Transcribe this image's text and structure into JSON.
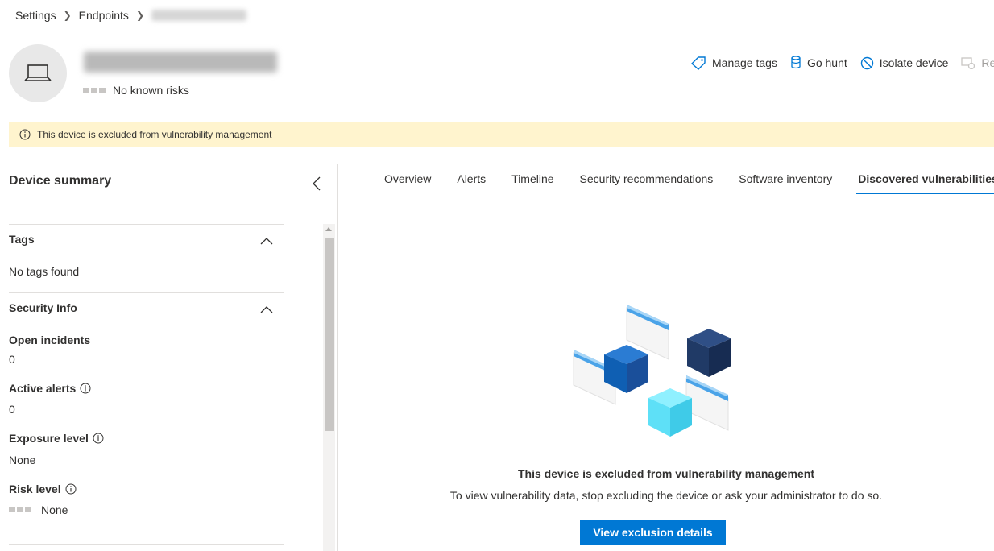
{
  "breadcrumb": {
    "items": [
      "Settings",
      "Endpoints"
    ],
    "current_redacted": true
  },
  "device": {
    "name_redacted": true,
    "risk_text": "No known risks"
  },
  "actions": [
    {
      "label": "Manage tags",
      "icon": "tag-icon"
    },
    {
      "label": "Go hunt",
      "icon": "hunt-icon"
    },
    {
      "label": "Isolate device",
      "icon": "block-icon"
    },
    {
      "label": "Re",
      "icon": "restrict-icon",
      "disabled": true
    }
  ],
  "banner": {
    "text": "This device is excluded from vulnerability management",
    "color": "#fff4ce"
  },
  "summary": {
    "title": "Device summary",
    "tags_section": {
      "title": "Tags",
      "empty_text": "No tags found"
    },
    "security_section": {
      "title": "Security Info",
      "fields": [
        {
          "label": "Open incidents",
          "value": "0",
          "info": false
        },
        {
          "label": "Active alerts",
          "value": "0",
          "info": true
        },
        {
          "label": "Exposure level",
          "value": "None",
          "info": true
        },
        {
          "label": "Risk level",
          "value": "None",
          "info": true
        }
      ]
    }
  },
  "tabs": [
    {
      "label": "Overview",
      "active": false
    },
    {
      "label": "Alerts",
      "active": false
    },
    {
      "label": "Timeline",
      "active": false
    },
    {
      "label": "Security recommendations",
      "active": false
    },
    {
      "label": "Software inventory",
      "active": false
    },
    {
      "label": "Discovered vulnerabilities",
      "active": true
    }
  ],
  "empty_state": {
    "title": "This device is excluded from vulnerability management",
    "message": "To view vulnerability data, stop excluding the device or ask your administrator to do so.",
    "button_label": "View exclusion details"
  },
  "colors": {
    "accent": "#0078d4",
    "banner": "#fff4ce"
  }
}
